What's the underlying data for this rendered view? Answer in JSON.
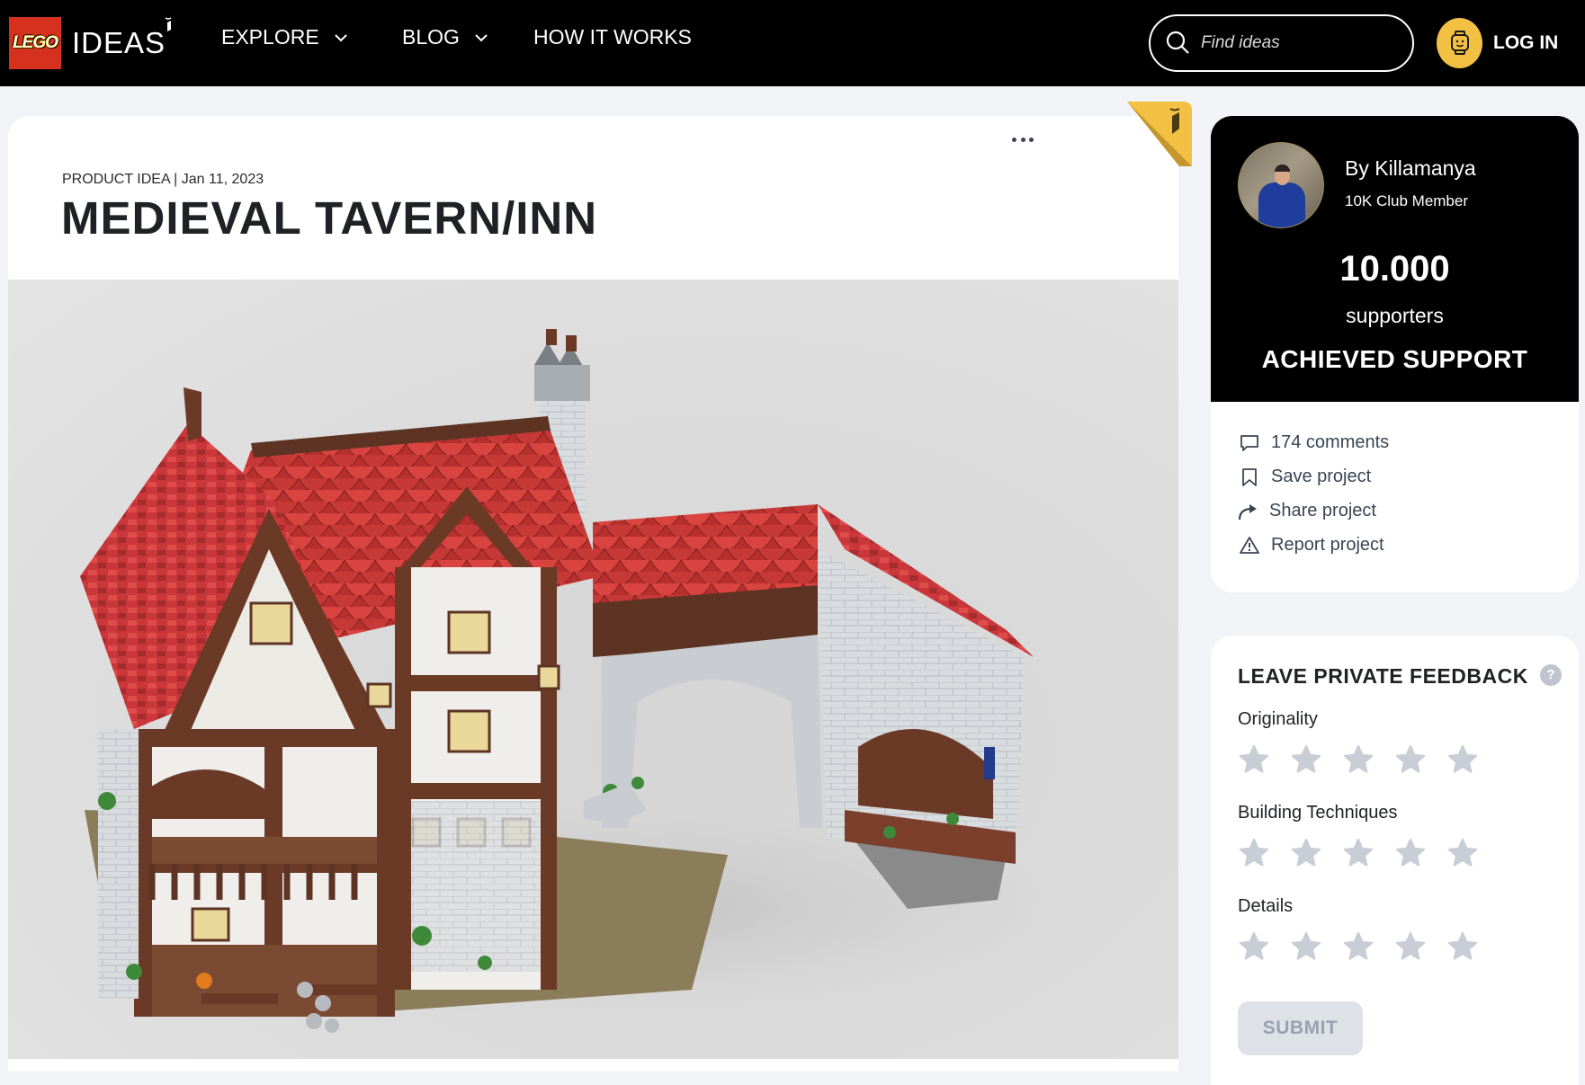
{
  "header": {
    "brand_lego": "LEGO",
    "brand_ideas": "IDEAS",
    "nav": [
      {
        "label": "EXPLORE",
        "has_dropdown": true
      },
      {
        "label": "BLOG",
        "has_dropdown": true
      },
      {
        "label": "HOW IT WORKS",
        "has_dropdown": false
      }
    ],
    "search": {
      "placeholder": "Find ideas",
      "value": ""
    },
    "login_label": "LOG IN"
  },
  "project": {
    "type": "PRODUCT IDEA",
    "date": "Jan 11, 2023",
    "meta_line": "PRODUCT IDEA | Jan 11, 2023",
    "title": "MEDIEVAL TAVERN/INN",
    "more_menu_icon": "ellipsis-icon",
    "image_alt": "LEGO model of a medieval tavern with red tiled roofs, timber framing and stone walls"
  },
  "creator": {
    "by_line": "By Killamanya",
    "badge": "10K Club Member",
    "supporters_count": "10.000",
    "supporters_label": "supporters",
    "status": "ACHIEVED SUPPORT"
  },
  "actions": [
    {
      "icon": "comment-icon",
      "label": "174 comments"
    },
    {
      "icon": "bookmark-icon",
      "label": "Save project"
    },
    {
      "icon": "share-icon",
      "label": "Share project"
    },
    {
      "icon": "warning-icon",
      "label": "Report project"
    }
  ],
  "feedback": {
    "title": "LEAVE PRIVATE FEEDBACK",
    "help": "?",
    "categories": [
      {
        "label": "Originality",
        "rating": 0,
        "max": 5
      },
      {
        "label": "Building Techniques",
        "rating": 0,
        "max": 5
      },
      {
        "label": "Details",
        "rating": 0,
        "max": 5
      }
    ],
    "submit_label": "SUBMIT"
  },
  "colors": {
    "header_bg": "#000000",
    "page_bg": "#f2f3f7",
    "lego_red": "#d6311f",
    "accent_yellow": "#f2c043",
    "text_dark": "#1f2124",
    "text_muted": "#3a4554",
    "star_empty": "#c9cdd6"
  }
}
